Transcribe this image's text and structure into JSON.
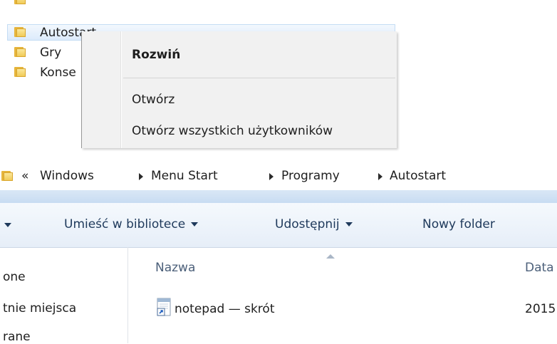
{
  "tree": {
    "items": [
      {
        "label": "Autostart"
      },
      {
        "label": "Gry"
      },
      {
        "label": "Konse"
      }
    ]
  },
  "context_menu": {
    "items": [
      {
        "label": "Rozwiń"
      },
      {
        "label": "Otwórz"
      },
      {
        "label": "Otwórz wszystkich użytkowników"
      }
    ]
  },
  "address_bar": {
    "overflow": "«",
    "crumbs": [
      "Windows",
      "Menu Start",
      "Programy",
      "Autostart"
    ]
  },
  "toolbar": {
    "library_label": "Umieść w bibliotece",
    "share_label": "Udostępnij",
    "new_folder_label": "Nowy folder"
  },
  "nav_pane": {
    "items": [
      "one",
      "tnie miejsca",
      "rane"
    ]
  },
  "file_list": {
    "columns": [
      "Nazwa",
      "Data"
    ],
    "rows": [
      {
        "name": "notepad — skrót",
        "date": "2015"
      }
    ]
  },
  "colors": {
    "highlight": "#ffff3b",
    "selection": "#dcebfc",
    "toolbar_text": "#1e395b"
  }
}
